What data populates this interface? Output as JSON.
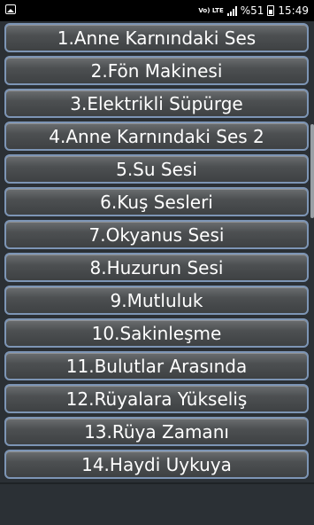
{
  "status_bar": {
    "network": "Vo) LTE",
    "battery": "%51",
    "time": "15:49"
  },
  "items": [
    {
      "label": "1.Anne Karnındaki Ses"
    },
    {
      "label": "2.Fön Makinesi"
    },
    {
      "label": "3.Elektrikli Süpürge"
    },
    {
      "label": "4.Anne Karnındaki Ses 2"
    },
    {
      "label": "5.Su Sesi"
    },
    {
      "label": "6.Kuş Sesleri"
    },
    {
      "label": "7.Okyanus Sesi"
    },
    {
      "label": "8.Huzurun Sesi"
    },
    {
      "label": "9.Mutluluk"
    },
    {
      "label": "10.Sakinleşme"
    },
    {
      "label": "11.Bulutlar Arasında"
    },
    {
      "label": "12.Rüyalara Yükseliş"
    },
    {
      "label": "13.Rüya Zamanı"
    },
    {
      "label": "14.Haydi Uykuya"
    }
  ]
}
